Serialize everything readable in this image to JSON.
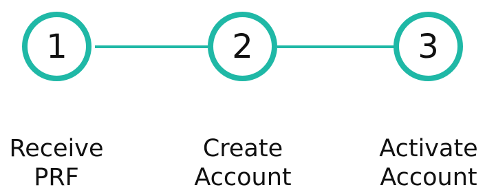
{
  "steps": [
    {
      "number": "1",
      "label_line1": "Receive",
      "label_line2": "PRF"
    },
    {
      "number": "2",
      "label_line1": "Create",
      "label_line2": "Account"
    },
    {
      "number": "3",
      "label_line1": "Activate",
      "label_line2": "Account"
    }
  ],
  "colors": {
    "accent": "#1fb8a6",
    "text": "#111111",
    "background": "#ffffff"
  }
}
